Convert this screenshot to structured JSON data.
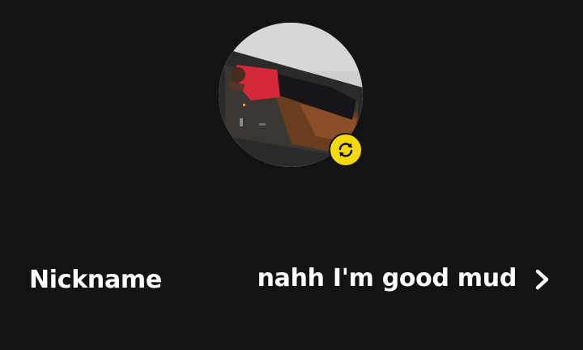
{
  "profile": {
    "avatar_icon": "profile-photo",
    "swap_icon": "refresh-icon",
    "badge_color": "#f5d90a"
  },
  "nickname_row": {
    "label": "Nickname",
    "value": "nahh I'm good mud",
    "chevron_icon": "chevron-right-icon"
  }
}
